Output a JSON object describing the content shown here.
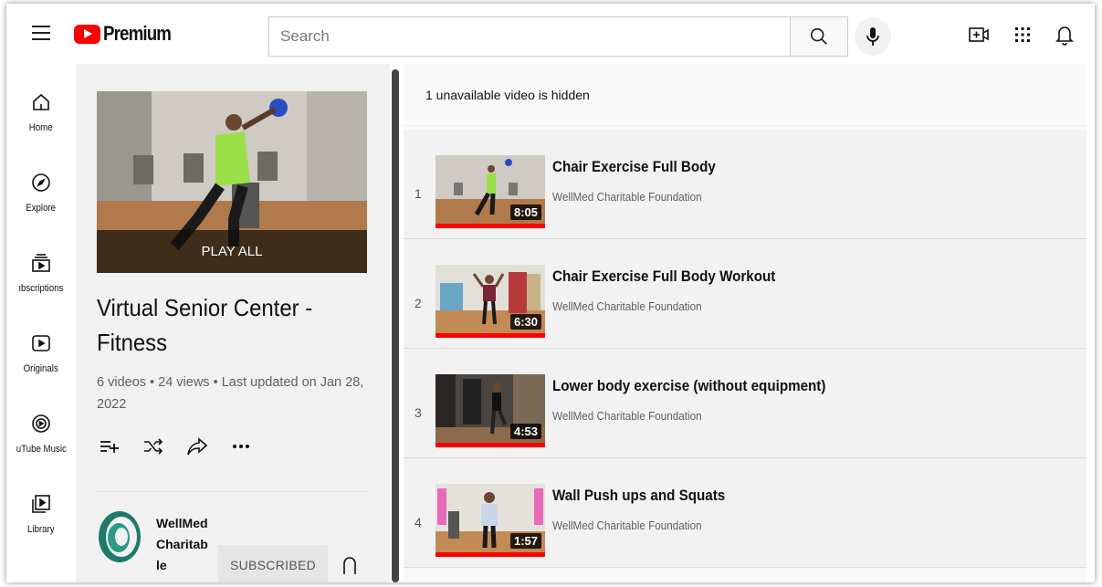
{
  "header": {
    "logo_text": "Premium",
    "search_placeholder": "Search"
  },
  "nav": [
    {
      "label": "Home",
      "icon": "home-icon"
    },
    {
      "label": "Explore",
      "icon": "compass-icon"
    },
    {
      "label": "ıbscriptions",
      "icon": "subscriptions-icon"
    },
    {
      "label": "Originals",
      "icon": "originals-icon"
    },
    {
      "label": "uTube Music",
      "icon": "music-icon"
    },
    {
      "label": "Library",
      "icon": "library-icon"
    }
  ],
  "playlist": {
    "play_all_label": "PLAY ALL",
    "title": "Virtual Senior Center - Fitness",
    "meta": "6 videos • 24 views • Last updated on Jan 28, 2022",
    "channel_name": "WellMed Charitab le",
    "subscribe_label": "SUBSCRIBED"
  },
  "notice": "1 unavailable video is hidden",
  "videos": [
    {
      "index": "1",
      "title": "Chair Exercise Full Body",
      "channel": "WellMed Charitable Foundation",
      "duration": "8:05"
    },
    {
      "index": "2",
      "title": "Chair Exercise Full Body Workout",
      "channel": "WellMed Charitable Foundation",
      "duration": "6:30"
    },
    {
      "index": "3",
      "title": "Lower body exercise (without equipment)",
      "channel": "WellMed Charitable Foundation",
      "duration": "4:53"
    },
    {
      "index": "4",
      "title": "Wall Push ups and Squats",
      "channel": "WellMed Charitable Foundation",
      "duration": "1:57"
    }
  ],
  "colors": {
    "brand_red": "#ff0000",
    "sidebar_bg": "#f1f1f1",
    "text_secondary": "#606060"
  }
}
